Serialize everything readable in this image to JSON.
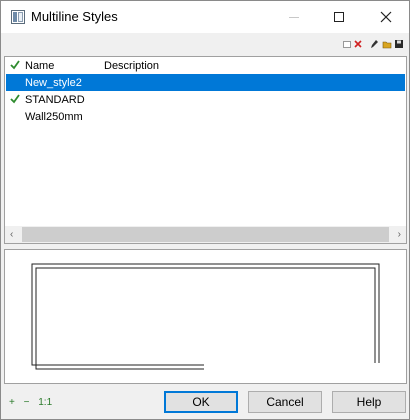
{
  "window": {
    "title": "Multiline Styles"
  },
  "toolbar": {
    "icons": [
      "new-icon",
      "delete-icon",
      "edit-icon",
      "open-icon",
      "save-icon"
    ]
  },
  "list": {
    "columns": [
      "Name",
      "Description"
    ],
    "rows": [
      {
        "name": "New_style2",
        "description": "",
        "checked": false,
        "selected": true
      },
      {
        "name": "STANDARD",
        "description": "",
        "checked": true,
        "selected": false
      },
      {
        "name": "Wall250mm",
        "description": "",
        "checked": false,
        "selected": false
      }
    ]
  },
  "bottom": {
    "add_label": "+",
    "remove_label": "−",
    "ratio_label": "1:1"
  },
  "buttons": {
    "ok": "OK",
    "cancel": "Cancel",
    "help": "Help"
  },
  "colors": {
    "selection": "#0078d7",
    "check": "#2e8b2e",
    "delete": "#d02020"
  }
}
